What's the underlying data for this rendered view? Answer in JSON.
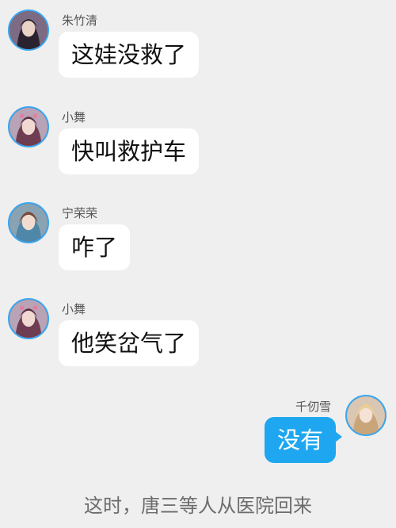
{
  "messages": [
    {
      "sender": "朱竹清",
      "text": "这娃没救了",
      "side": "left",
      "avatar_icon": "character-avatar-icon"
    },
    {
      "sender": "小舞",
      "text": "快叫救护车",
      "side": "left",
      "avatar_icon": "character-avatar-icon"
    },
    {
      "sender": "宁荣荣",
      "text": "咋了",
      "side": "left",
      "avatar_icon": "character-avatar-icon"
    },
    {
      "sender": "小舞",
      "text": "他笑岔气了",
      "side": "left",
      "avatar_icon": "character-avatar-icon"
    },
    {
      "sender": "千仞雪",
      "text": "没有",
      "side": "right",
      "avatar_icon": "character-avatar-icon"
    }
  ],
  "narration": "这时，唐三等人从医院回来",
  "colors": {
    "background": "#efefef",
    "self_bubble": "#1ea7f0",
    "other_bubble": "#ffffff",
    "avatar_ring": "#3aa7f0"
  }
}
